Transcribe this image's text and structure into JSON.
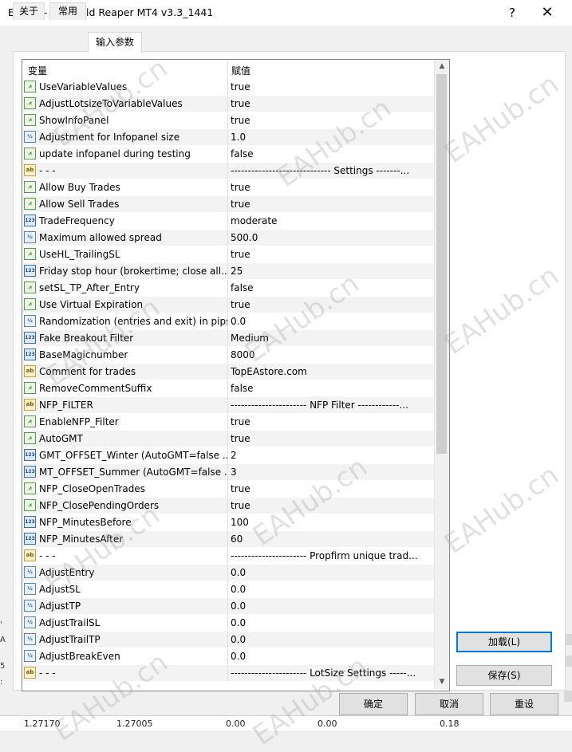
{
  "window": {
    "title": "Expert - The Gold Reaper MT4 v3.3_1441",
    "help_label": "?",
    "close_label": "✕"
  },
  "tabs": [
    {
      "label": "关于"
    },
    {
      "label": "常用"
    },
    {
      "label": "输入参数"
    }
  ],
  "grid": {
    "col_variable": "变量",
    "col_value": "赋值",
    "rows": [
      {
        "icon": "bool-icon",
        "name": "UseVariableValues",
        "value": "true"
      },
      {
        "icon": "bool-icon",
        "name": "AdjustLotsizeToVariableValues",
        "value": "true"
      },
      {
        "icon": "bool-icon",
        "name": "ShowInfoPanel",
        "value": "true"
      },
      {
        "icon": "double-icon",
        "name": "Adjustment for Infopanel size",
        "value": "1.0"
      },
      {
        "icon": "bool-icon",
        "name": "update infopanel during testing",
        "value": "false"
      },
      {
        "icon": "string-icon",
        "name": "- - -",
        "value": "----------------------------- Settings -------..."
      },
      {
        "icon": "bool-icon",
        "name": "Allow Buy Trades",
        "value": "true"
      },
      {
        "icon": "bool-icon",
        "name": "Allow Sell Trades",
        "value": "true"
      },
      {
        "icon": "int-icon",
        "name": "TradeFrequency",
        "value": "moderate"
      },
      {
        "icon": "double-icon",
        "name": "Maximum allowed spread",
        "value": "500.0"
      },
      {
        "icon": "bool-icon",
        "name": "UseHL_TrailingSL",
        "value": "true"
      },
      {
        "icon": "int-icon",
        "name": "Friday stop hour (brokertime; close all...",
        "value": "25"
      },
      {
        "icon": "bool-icon",
        "name": "setSL_TP_After_Entry",
        "value": "false"
      },
      {
        "icon": "bool-icon",
        "name": "Use Virtual Expiration",
        "value": "true"
      },
      {
        "icon": "double-icon",
        "name": "Randomization (entries and exit) in pips",
        "value": "0.0"
      },
      {
        "icon": "int-icon",
        "name": "Fake Breakout Filter",
        "value": "Medium"
      },
      {
        "icon": "int-icon",
        "name": "BaseMagicnumber",
        "value": "8000"
      },
      {
        "icon": "string-icon",
        "name": "Comment for trades",
        "value": "TopEAstore.com"
      },
      {
        "icon": "bool-icon",
        "name": "RemoveCommentSuffix",
        "value": "false"
      },
      {
        "icon": "string-icon",
        "name": "NFP_FILTER",
        "value": "---------------------- NFP Filter ------------..."
      },
      {
        "icon": "bool-icon",
        "name": "EnableNFP_Filter",
        "value": "true"
      },
      {
        "icon": "bool-icon",
        "name": "AutoGMT",
        "value": "true"
      },
      {
        "icon": "int-icon",
        "name": "GMT_OFFSET_Winter (AutoGMT=false ...",
        "value": "2"
      },
      {
        "icon": "int-icon",
        "name": "MT_OFFSET_Summer (AutoGMT=false ...",
        "value": "3"
      },
      {
        "icon": "bool-icon",
        "name": "NFP_CloseOpenTrades",
        "value": "true"
      },
      {
        "icon": "bool-icon",
        "name": "NFP_ClosePendingOrders",
        "value": "true"
      },
      {
        "icon": "int-icon",
        "name": "NFP_MinutesBefore",
        "value": "100"
      },
      {
        "icon": "int-icon",
        "name": "NFP_MinutesAfter",
        "value": "60"
      },
      {
        "icon": "string-icon",
        "name": "- - -",
        "value": "---------------------- Propfirm unique trad..."
      },
      {
        "icon": "double-icon",
        "name": "AdjustEntry",
        "value": "0.0"
      },
      {
        "icon": "double-icon",
        "name": "AdjustSL",
        "value": "0.0"
      },
      {
        "icon": "double-icon",
        "name": "AdjustTP",
        "value": "0.0"
      },
      {
        "icon": "double-icon",
        "name": "AdjustTrailSL",
        "value": "0.0"
      },
      {
        "icon": "double-icon",
        "name": "AdjustTrailTP",
        "value": "0.0"
      },
      {
        "icon": "double-icon",
        "name": "AdjustBreakEven",
        "value": "0.0"
      },
      {
        "icon": "string-icon",
        "name": "- - -",
        "value": "---------------------- LotSize Settings -----..."
      }
    ]
  },
  "icon_glyphs": {
    "bool-icon": "⩘",
    "double-icon": "½",
    "int-icon": "123",
    "string-icon": "ab"
  },
  "buttons": {
    "load": "加载(L)",
    "save": "保存(S)",
    "ok": "确定",
    "cancel": "取消",
    "reset": "重设"
  },
  "watermark": "EAHub.cn",
  "background": {
    "left_letters": [
      "'",
      "A",
      "5",
      ":"
    ],
    "numbers": [
      "1.27170",
      "1.27005",
      "0.00",
      "0.00",
      "0.18"
    ]
  },
  "colors": {
    "accent": "#0078d7",
    "row_alt": "#f3f3f3"
  }
}
